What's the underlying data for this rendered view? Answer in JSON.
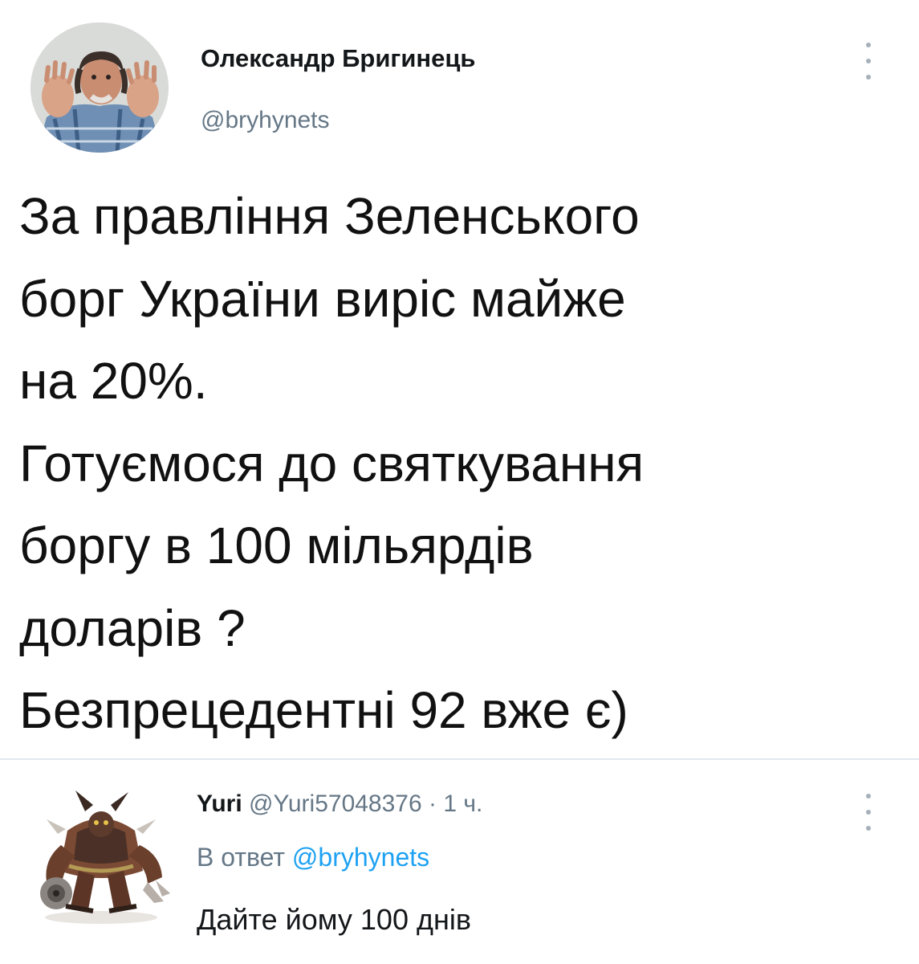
{
  "main_tweet": {
    "author_name": "Олександр Бригинець",
    "author_handle": "@bryhynets",
    "text_lines": [
      "За правління Зеленського",
      "борг України виріс майже",
      "на 20%.",
      "Готуємося до святкування",
      "боргу в 100 мільярдів",
      "доларів ?",
      "Безпрецедентні 92 вже є)"
    ]
  },
  "reply": {
    "author_name": "Yuri",
    "author_handle": "@Yuri57048376",
    "separator": "·",
    "time": "1 ч.",
    "context_prefix": "В ответ",
    "context_mention": "@bryhynets",
    "text": "Дайте йому 100 днів"
  },
  "icons": {
    "more": "more-vertical-icon"
  },
  "colors": {
    "text_primary": "#14171a",
    "text_secondary": "#657786",
    "link": "#1da1f2",
    "divider": "#e1e8ed"
  }
}
